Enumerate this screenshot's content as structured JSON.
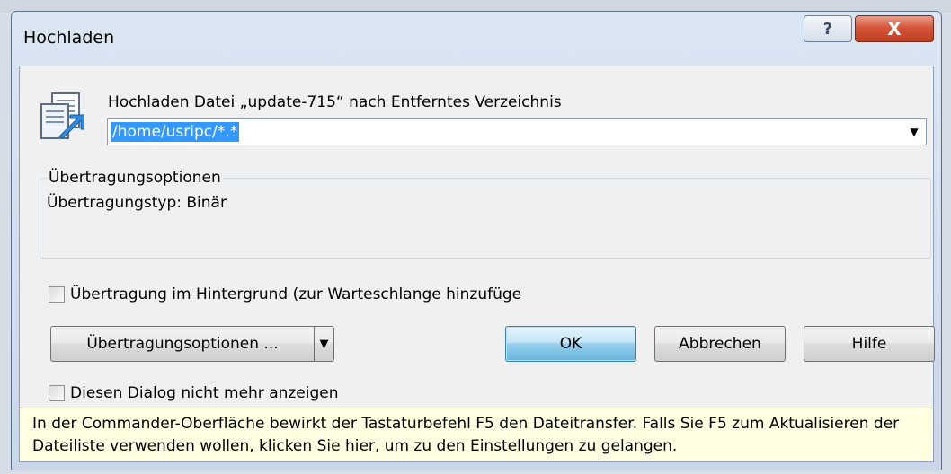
{
  "window": {
    "title": "Hochladen",
    "help_glyph": "?",
    "close_glyph": "X"
  },
  "target": {
    "label": "Hochladen Datei „update-715“ nach Entferntes Verzeichnis",
    "value": "/home/usripc/*.*",
    "dropdown_glyph": "▼"
  },
  "options_group": {
    "title": "Übertragungsoptionen",
    "transfer_type": "Übertragungstyp: Binär"
  },
  "background_checkbox": {
    "label": "Übertragung im Hintergrund (zur Warteschlange hinzufüge",
    "checked": false
  },
  "buttons": {
    "options_label": "Übertragungsoptionen ...",
    "options_arrow": "▼",
    "ok_label": "OK",
    "cancel_label": "Abbrechen",
    "help_label": "Hilfe"
  },
  "dont_show_checkbox": {
    "label": "Diesen Dialog nicht mehr anzeigen",
    "checked": false
  },
  "info": {
    "text": "In der Commander-Oberfläche bewirkt der Tastaturbefehl F5 den Dateitransfer. Falls Sie F5 zum Aktualisieren der Dateiliste verwenden wollen, klicken Sie hier, um zu den Einstellungen zu gelangen."
  },
  "colors": {
    "selection": "#3399ff",
    "info_background": "#ffffe1",
    "close_button": "#c23d1f"
  }
}
